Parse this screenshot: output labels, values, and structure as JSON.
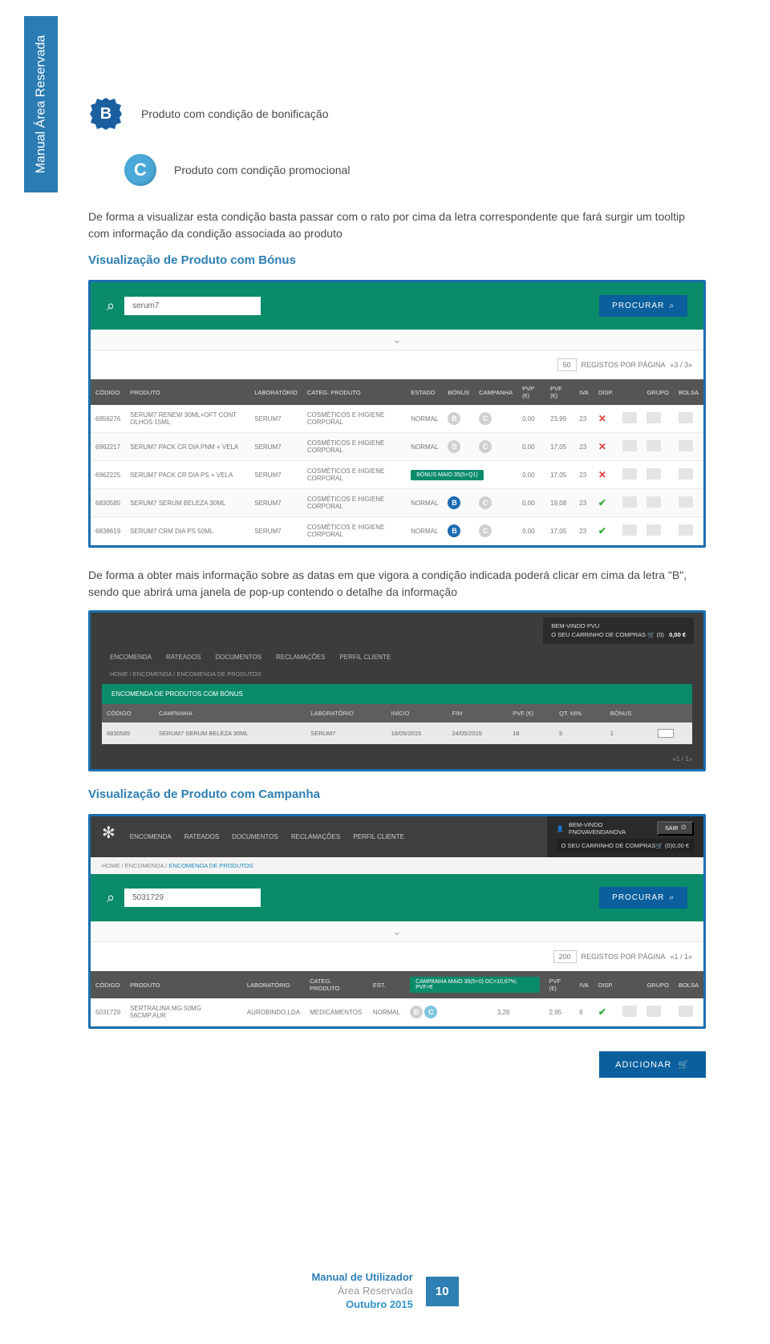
{
  "side_tab_label": "Manual Área Reservada",
  "icons": {
    "b_label": "Produto com condição de bonificação",
    "c_label": "Produto com condição promocional"
  },
  "paragraph1": "De forma a visualizar esta condição basta passar com o rato por cima da letra correspondente que fará surgir um tooltip com informação da condição associada ao produto",
  "heading1": "Visualização de Produto com Bónus",
  "shot1": {
    "search_value": "serum7",
    "search_button": "PROCURAR",
    "pager_value": "50",
    "pager_label": "REGISTOS POR PÁGINA",
    "pager_nav": "«3 / 3»",
    "columns": [
      "CÓDIGO",
      "PRODUTO",
      "LABORATÓRIO",
      "CATEG. PRODUTO",
      "ESTADO",
      "BÓNUS",
      "CAMPANHA",
      "PVP (€)",
      "PVF (€)",
      "IVA",
      "DISP.",
      "",
      "GRUPO",
      "BOLSA"
    ],
    "rows": [
      {
        "codigo": "6956276",
        "produto": "SERUM7 RENEW 30ML+OFT CONT OLHOS 15ML",
        "lab": "SERUM7",
        "categ": "COSMÉTICOS E HIGIENE CORPORAL",
        "estado": "NORMAL",
        "b": "B",
        "c": "C",
        "pvp": "0,00",
        "pvf": "23,99",
        "iva": "23",
        "disp": "x",
        "tag": ""
      },
      {
        "codigo": "6962217",
        "produto": "SERUM7 PACK CR DIA PNM + VELA",
        "lab": "SERUM7",
        "categ": "COSMÉTICOS E HIGIENE CORPORAL",
        "estado": "NORMAL",
        "b": "B",
        "c": "C",
        "pvp": "0,00",
        "pvf": "17,05",
        "iva": "23",
        "disp": "x",
        "tag": ""
      },
      {
        "codigo": "6962225",
        "produto": "SERUM7 PACK CR DIA PS + VELA",
        "lab": "SERUM7",
        "categ": "COSMÉTICOS E HIGIENE CORPORAL",
        "estado": "",
        "b": "",
        "c": "",
        "pvp": "0,00",
        "pvf": "17,05",
        "iva": "23",
        "disp": "x",
        "tag": "BÓNUS MAIO 35(5+Q1)"
      },
      {
        "codigo": "6830585",
        "produto": "SERUM7 SERUM BELEZA 30ML",
        "lab": "SERUM7",
        "categ": "COSMÉTICOS E HIGIENE CORPORAL",
        "estado": "NORMAL",
        "b": "B-blue",
        "c": "C",
        "pvp": "0,00",
        "pvf": "19,08",
        "iva": "23",
        "disp": "ok",
        "tag": ""
      },
      {
        "codigo": "6838619",
        "produto": "SERUM7 CRM DIA PS 50ML",
        "lab": "SERUM7",
        "categ": "COSMÉTICOS E HIGIENE CORPORAL",
        "estado": "NORMAL",
        "b": "B-blue",
        "c": "C",
        "pvp": "0,00",
        "pvf": "17,05",
        "iva": "23",
        "disp": "ok",
        "tag": ""
      }
    ]
  },
  "paragraph2": "De forma a obter mais informação sobre as datas em que vigora a condição indicada poderá clicar em cima da letra \"B\", sendo que abrirá uma janela de pop-up contendo o detalhe da informação",
  "shot2": {
    "welcome_label": "BEM-VINDO",
    "welcome_user": "PVU",
    "cart_label": "O SEU CARRINHO DE COMPRAS",
    "cart_count": "(0)",
    "cart_amount": "0,00 €",
    "nav": [
      "ENCOMENDA",
      "RATEADOS",
      "DOCUMENTOS",
      "RECLAMAÇÕES",
      "PERFIL CLIENTE"
    ],
    "crumb": "HOME / ENCOMENDA / ENCOMENDA DE PRODUTOS",
    "title_bar": "ENCOMENDA DE PRODUTOS COM BÓNUS",
    "columns": [
      "CÓDIGO",
      "CAMPANHA",
      "LABORATÓRIO",
      "INÍCIO",
      "FIM",
      "PVF (€)",
      "QT. MIN.",
      "BÓNUS",
      ""
    ],
    "row": {
      "codigo": "6830585",
      "campanha": "SERUM7 SERUM BELEZA 30ML",
      "lab": "SERUM7",
      "inicio": "18/05/2015",
      "fim": "24/05/2015",
      "pvf": "18",
      "qt": "5",
      "bonus": "1"
    },
    "pager": "«1 / 1»"
  },
  "heading2": "Visualização de Produto com Campanha",
  "shot3": {
    "nav": [
      "ENCOMENDA",
      "RATEADOS",
      "DOCUMENTOS",
      "RECLAMAÇÕES",
      "PERFIL CLIENTE"
    ],
    "welcome_label": "BEM-VINDO",
    "welcome_user": "FNOVAVENDANOVA",
    "sair": "SAIR",
    "cart_label": "O SEU CARRINHO DE COMPRAS",
    "cart_count": "(0)",
    "cart_amount": "0,00 €",
    "crumb_prefix": "HOME / ENCOMENDA /",
    "crumb_current": "ENCOMENDA DE PRODUTOS",
    "search_value": "5031729",
    "search_button": "PROCURAR",
    "pager_value": "200",
    "pager_label": "REGISTOS POR PÁGINA",
    "pager_nav": "«1 / 1»",
    "columns": [
      "CÓDIGO",
      "PRODUTO",
      "LABORATÓRIO",
      "CATEG. PRODUTO",
      "EST.",
      "",
      "",
      "PVF (€)",
      "IVA",
      "DISP.",
      "",
      "GRUPO",
      "BOLSA"
    ],
    "tooltip": "CAMPANHA MAIO 35(5+0) DC=10,67%; PVF=€",
    "row": {
      "codigo": "5031729",
      "produto": "SERTRALINA MG 50MG 56CMP.AUR",
      "lab": "AUROBINDO,LDA",
      "categ": "MEDICAMENTOS",
      "estado": "NORMAL",
      "pvf": "3,28",
      "col2": "2,95",
      "iva": "6",
      "disp": "ok"
    },
    "add_button": "ADICIONAR"
  },
  "footer": {
    "line1": "Manual de Utilizador",
    "line2": "Área Reservada",
    "line3": "Outubro 2015",
    "page": "10"
  }
}
